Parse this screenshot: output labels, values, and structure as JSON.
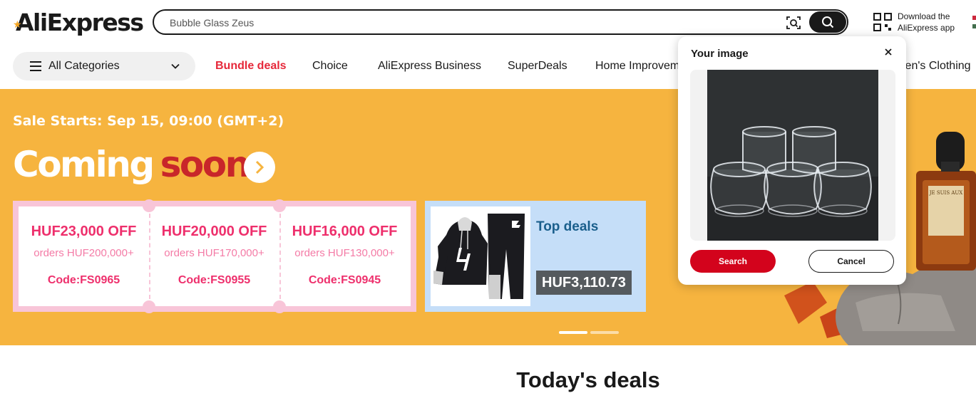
{
  "header": {
    "logo_text": "AliExpress",
    "search": {
      "value": "Bubble Glass Zeus"
    },
    "download": {
      "line1": "Download the",
      "line2": "AliExpress app"
    }
  },
  "nav": {
    "categories_label": "All Categories",
    "items": [
      "Bundle deals",
      "Choice",
      "AliExpress Business",
      "SuperDeals",
      "Home Improvem",
      "len's Clothing"
    ]
  },
  "banner": {
    "sale_text": "Sale Starts: Sep 15, 09:00 (GMT+2)",
    "headline_white": "Coming",
    "headline_red": "soon",
    "coupons": [
      {
        "amount": "HUF23,000 OFF",
        "orders": "orders HUF200,000+",
        "code": "Code:FS0965"
      },
      {
        "amount": "HUF20,000 OFF",
        "orders": "orders HUF170,000+",
        "code": "Code:FS0955"
      },
      {
        "amount": "HUF16,000 OFF",
        "orders": "orders HUF130,000+",
        "code": "Code:FS0945"
      }
    ],
    "top_deals": {
      "title": "Top deals",
      "price": "HUF3,110.73"
    },
    "product_label": "JE SUIS AUX"
  },
  "section": {
    "title": "Today's deals"
  },
  "popup": {
    "title": "Your image",
    "search_label": "Search",
    "cancel_label": "Cancel"
  },
  "colors": {
    "banner_bg": "#f6b43f",
    "accent_red": "#d3031c",
    "coupon_pink": "#ee2f6c",
    "topdeal_blue": "#c5def8"
  }
}
